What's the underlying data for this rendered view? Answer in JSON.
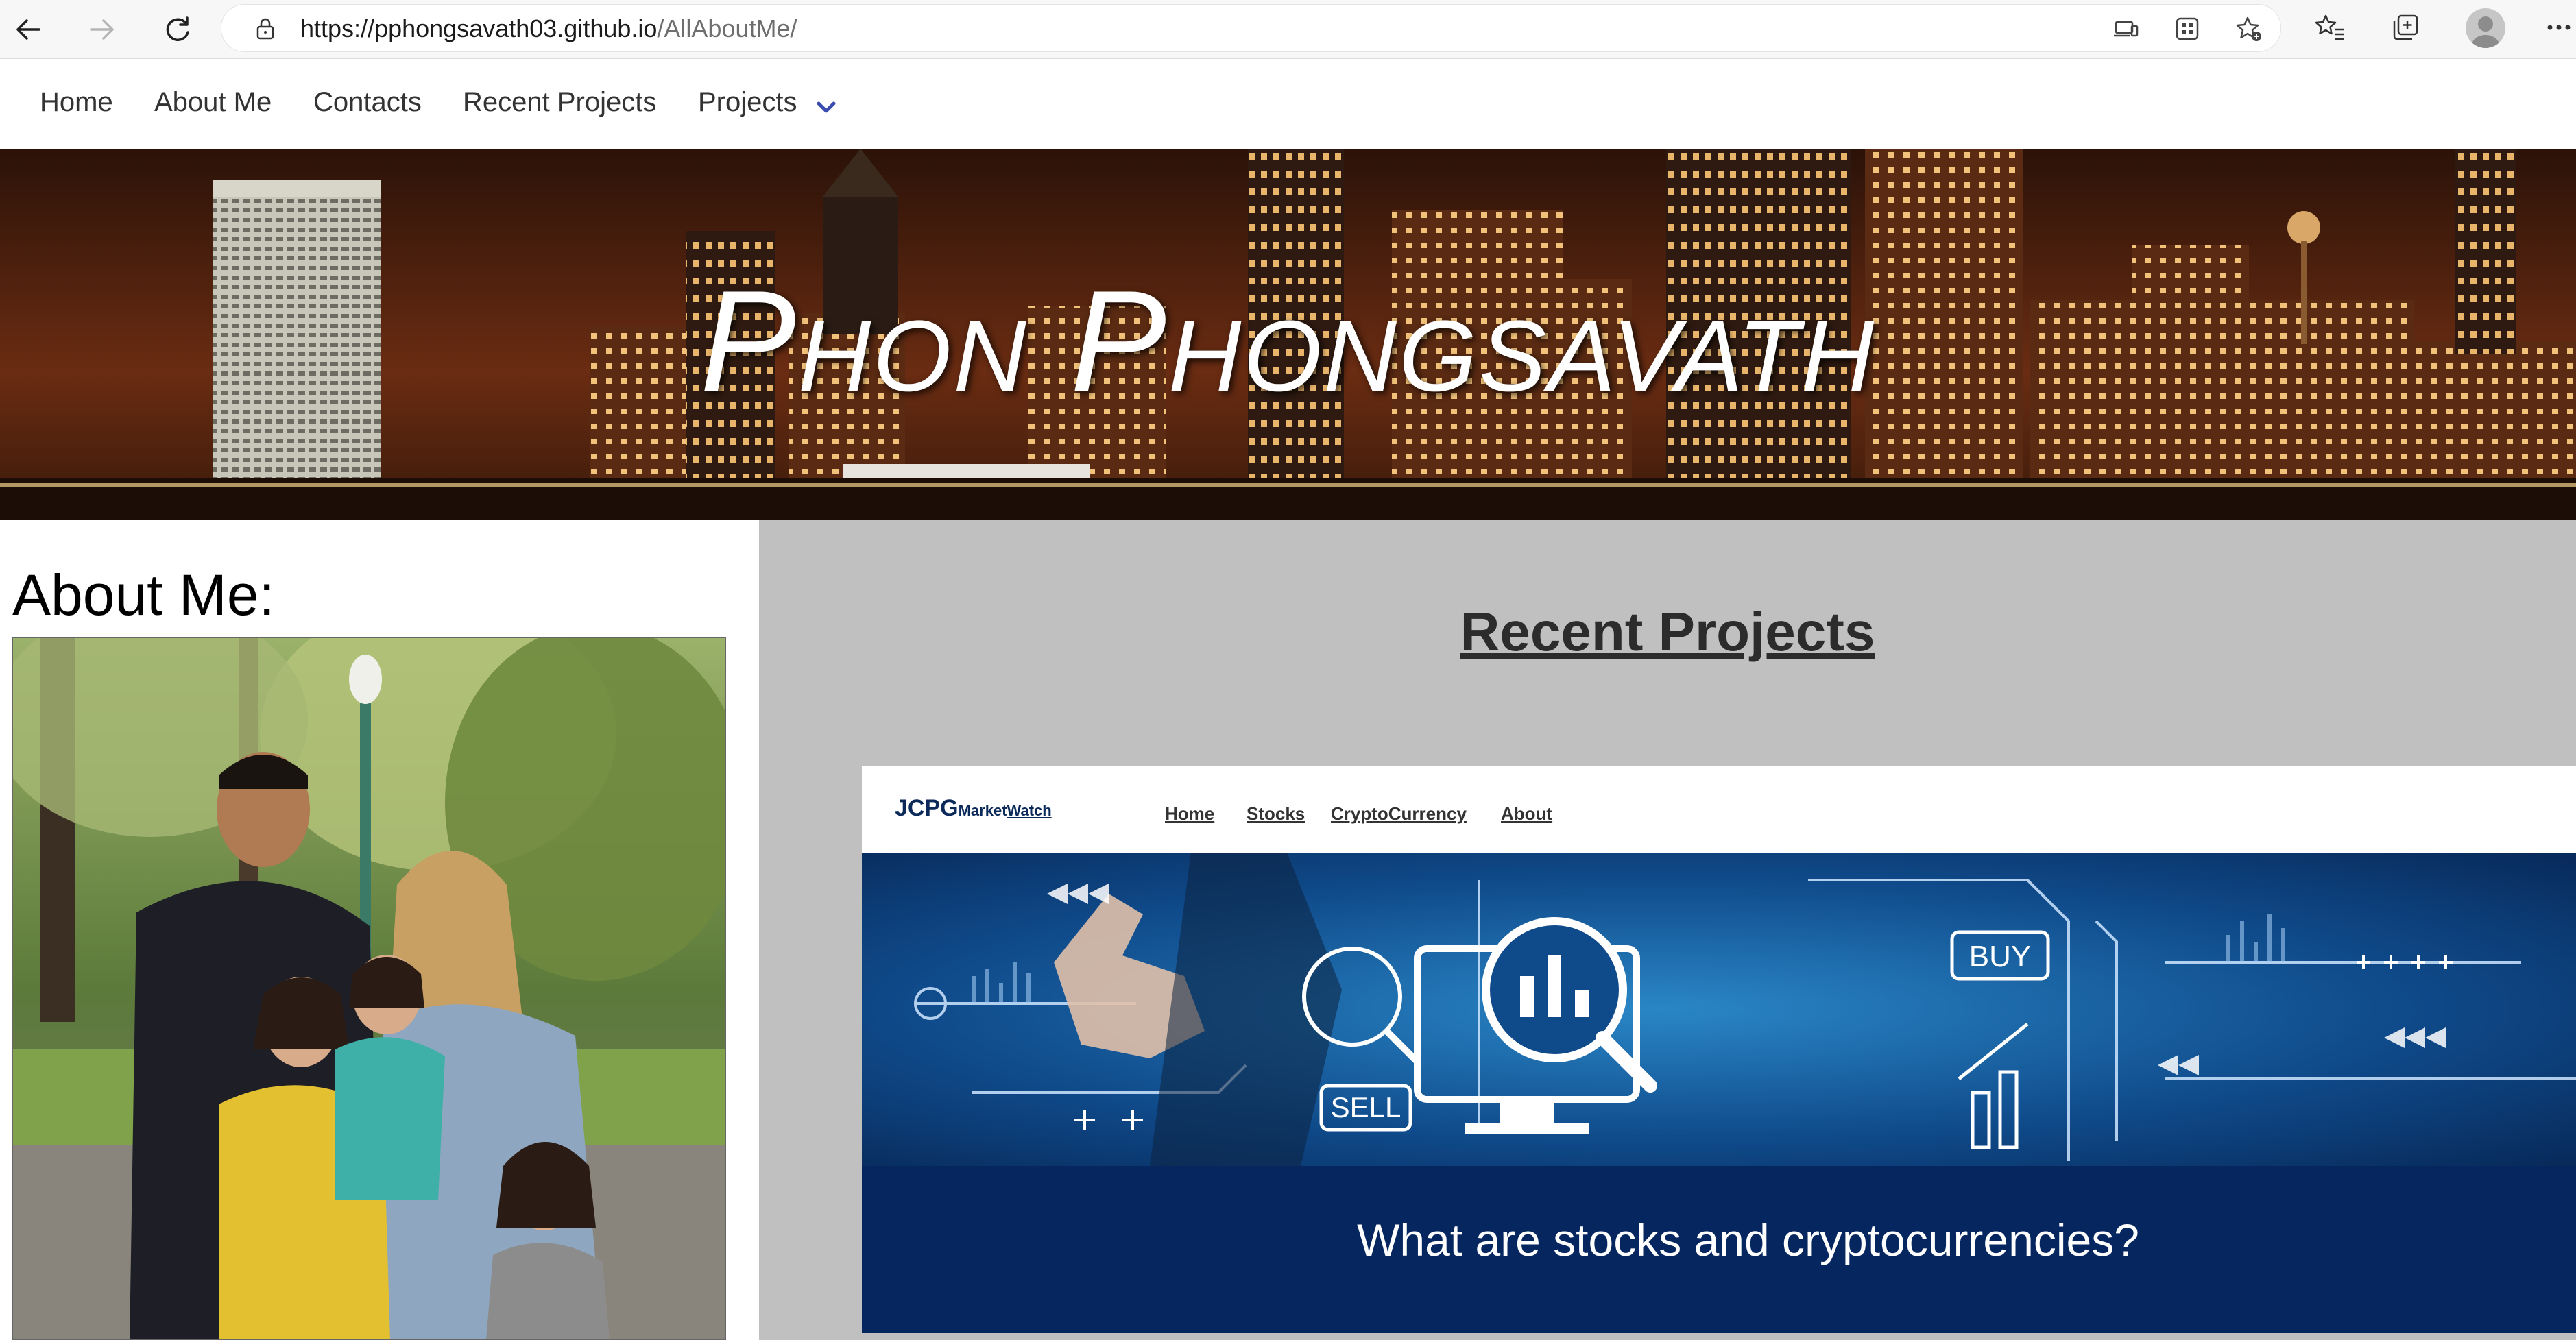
{
  "browser": {
    "url_host": "https://pphongsavath03.github.io",
    "url_path": "/AllAboutMe/",
    "icons": [
      "back-icon",
      "forward-icon",
      "refresh-icon",
      "lock-icon",
      "app-available-icon",
      "extensions-icon",
      "add-favorite-icon",
      "favorites-icon",
      "collections-icon",
      "profile-icon",
      "more-icon"
    ]
  },
  "site_nav": {
    "items": [
      {
        "label": "Home"
      },
      {
        "label": "About Me"
      },
      {
        "label": "Contacts"
      },
      {
        "label": "Recent Projects"
      },
      {
        "label": "Projects"
      }
    ]
  },
  "banner": {
    "title": "Phon Phongsavath"
  },
  "about": {
    "heading": "About Me:"
  },
  "projects": {
    "heading": "Recent Projects",
    "card": {
      "logo_main": "JCPG",
      "logo_sub_a": "Market",
      "logo_sub_b": "Watch",
      "nav": [
        "Home",
        "Stocks",
        "CryptoCurrency",
        "About"
      ],
      "buy_label": "BUY",
      "sell_label": "SELL",
      "caption": "What are stocks and cryptocurrencies?"
    }
  },
  "colors": {
    "nav_text": "#333333",
    "accent_chevron": "#3b4db0",
    "right_panel_bg": "#c0c0c0",
    "hero_blue": "#0f4a8a",
    "caption_bar": "#06265f"
  }
}
